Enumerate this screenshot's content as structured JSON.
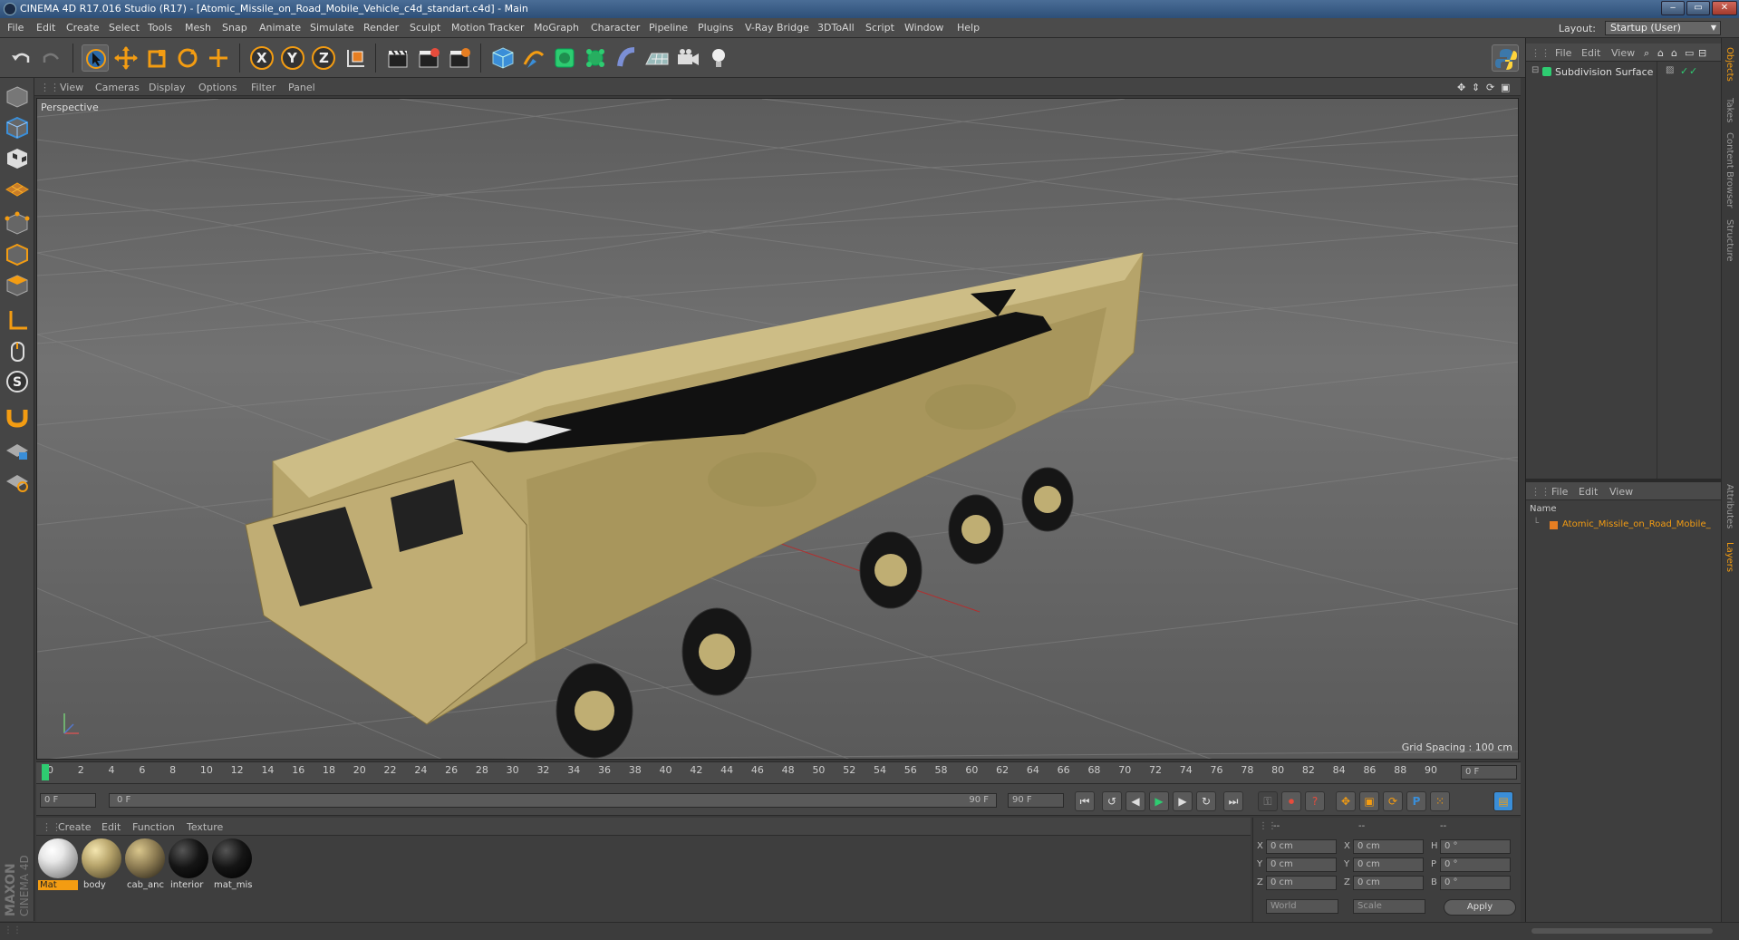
{
  "window": {
    "title": "CINEMA 4D R17.016 Studio (R17) - [Atomic_Missile_on_Road_Mobile_Vehicle_c4d_standart.c4d] - Main",
    "controls": [
      "‒",
      "▭",
      "✕"
    ]
  },
  "menubar": {
    "items": [
      "File",
      "Edit",
      "Create",
      "Select",
      "Tools",
      "Mesh",
      "Snap",
      "Animate",
      "Simulate",
      "Render",
      "Sculpt",
      "Motion Tracker",
      "MoGraph",
      "Character",
      "Pipeline",
      "Plugins",
      "V-Ray Bridge",
      "3DToAll",
      "Script",
      "Window",
      "Help"
    ],
    "layout_label": "Layout:",
    "layout_value": "Startup (User)"
  },
  "toolbar": {
    "axis_x": "X",
    "axis_y": "Y",
    "axis_z": "Z"
  },
  "viewport": {
    "menu": [
      "View",
      "Cameras",
      "Display",
      "Options",
      "Filter",
      "Panel"
    ],
    "label": "Perspective",
    "grid_spacing": "Grid Spacing : 100 cm"
  },
  "timeline": {
    "ticks": [
      "0",
      "2",
      "4",
      "6",
      "8",
      "10",
      "12",
      "14",
      "16",
      "18",
      "20",
      "22",
      "24",
      "26",
      "28",
      "30",
      "32",
      "34",
      "36",
      "38",
      "40",
      "42",
      "44",
      "46",
      "48",
      "50",
      "52",
      "54",
      "56",
      "58",
      "60",
      "62",
      "64",
      "66",
      "68",
      "70",
      "72",
      "74",
      "76",
      "78",
      "80",
      "82",
      "84",
      "86",
      "88",
      "90"
    ],
    "current_frame": "0 F",
    "playhead_fraction": 0
  },
  "playbar": {
    "start": "0 F",
    "range_start": "0 F",
    "range_end": "90 F",
    "end": "90 F"
  },
  "materials": {
    "menu": [
      "Create",
      "Edit",
      "Function",
      "Texture"
    ],
    "items": [
      {
        "label": "Mat",
        "color": "#e8e8e8",
        "selected": true
      },
      {
        "label": "body",
        "color": "#b8a56c",
        "selected": false
      },
      {
        "label": "cab_anc",
        "color": "#8c7b52",
        "selected": false
      },
      {
        "label": "interior",
        "color": "#151515",
        "selected": false
      },
      {
        "label": "mat_mis",
        "color": "#151515",
        "selected": false
      }
    ]
  },
  "coordinates": {
    "header": [
      "--",
      "--",
      "--"
    ],
    "rows": [
      {
        "a": "X",
        "av": "0 cm",
        "b": "X",
        "bv": "0 cm",
        "c": "H",
        "cv": "0 °"
      },
      {
        "a": "Y",
        "av": "0 cm",
        "b": "Y",
        "bv": "0 cm",
        "c": "P",
        "cv": "0 °"
      },
      {
        "a": "Z",
        "av": "0 cm",
        "b": "Z",
        "bv": "0 cm",
        "c": "B",
        "cv": "0 °"
      }
    ],
    "mode1": "World",
    "mode2": "Scale",
    "apply": "Apply"
  },
  "objects_panel": {
    "menu": [
      "File",
      "Edit",
      "View"
    ],
    "item": "Subdivision Surface"
  },
  "layers_panel": {
    "menu": [
      "File",
      "Edit",
      "View"
    ],
    "header": "Name",
    "item": "Atomic_Missile_on_Road_Mobile_"
  },
  "side_tabs": [
    "Objects",
    "Takes",
    "Content Browser",
    "Structure",
    "Attributes",
    "Layers"
  ],
  "brand": {
    "maxon": "MAXON",
    "product": "CINEMA 4D"
  },
  "colors": {
    "accent": "#f39c12",
    "selected_layer_text": "#f39c12"
  }
}
